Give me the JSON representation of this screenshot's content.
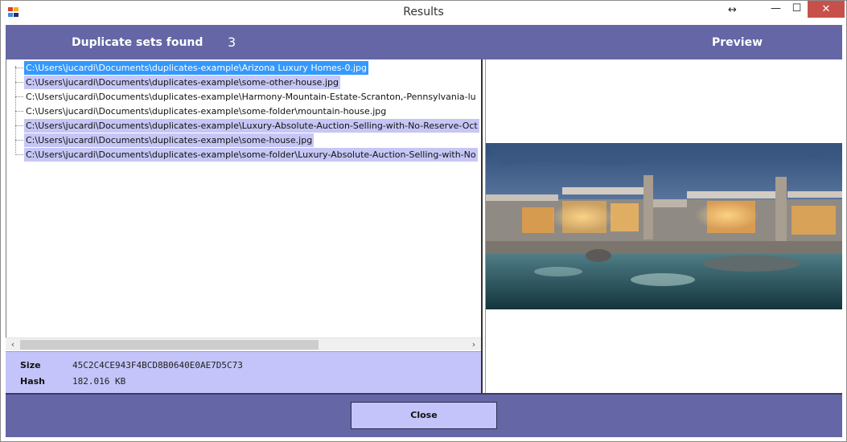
{
  "window": {
    "title": "Results",
    "controls": {
      "resize": "↔",
      "minimize": "—",
      "maximize": "☐",
      "close": "✕"
    }
  },
  "header": {
    "found_label": "Duplicate sets found",
    "found_count": "3",
    "preview_label": "Preview"
  },
  "files": [
    {
      "path": "C:\\Users\\jucardi\\Documents\\duplicates-example\\Arizona Luxury Homes-0.jpg",
      "state": "active"
    },
    {
      "path": "C:\\Users\\jucardi\\Documents\\duplicates-example\\some-other-house.jpg",
      "state": "group"
    },
    {
      "path": "C:\\Users\\jucardi\\Documents\\duplicates-example\\Harmony-Mountain-Estate-Scranton,-Pennsylvania-lu",
      "state": "none"
    },
    {
      "path": "C:\\Users\\jucardi\\Documents\\duplicates-example\\some-folder\\mountain-house.jpg",
      "state": "none"
    },
    {
      "path": "C:\\Users\\jucardi\\Documents\\duplicates-example\\Luxury-Absolute-Auction-Selling-with-No-Reserve-Oct",
      "state": "group"
    },
    {
      "path": "C:\\Users\\jucardi\\Documents\\duplicates-example\\some-house.jpg",
      "state": "group"
    },
    {
      "path": "C:\\Users\\jucardi\\Documents\\duplicates-example\\some-folder\\Luxury-Absolute-Auction-Selling-with-No",
      "state": "group"
    }
  ],
  "info": {
    "size_label": "Size",
    "size_value": "45C2C4CE943F4BCD8B0640E0AE7D5C73",
    "hash_label": "Hash",
    "hash_value": "182.016 KB"
  },
  "footer": {
    "close_label": "Close"
  },
  "colors": {
    "accent": "#6466a6",
    "panel": "#c4c4fa",
    "selection_active": "#3399ff",
    "selection_group": "#c6c6f6",
    "close_red": "#c7514a"
  },
  "icons": {
    "app": "app-icon",
    "scroll_left": "chevron-left-icon",
    "scroll_right": "chevron-right-icon"
  }
}
